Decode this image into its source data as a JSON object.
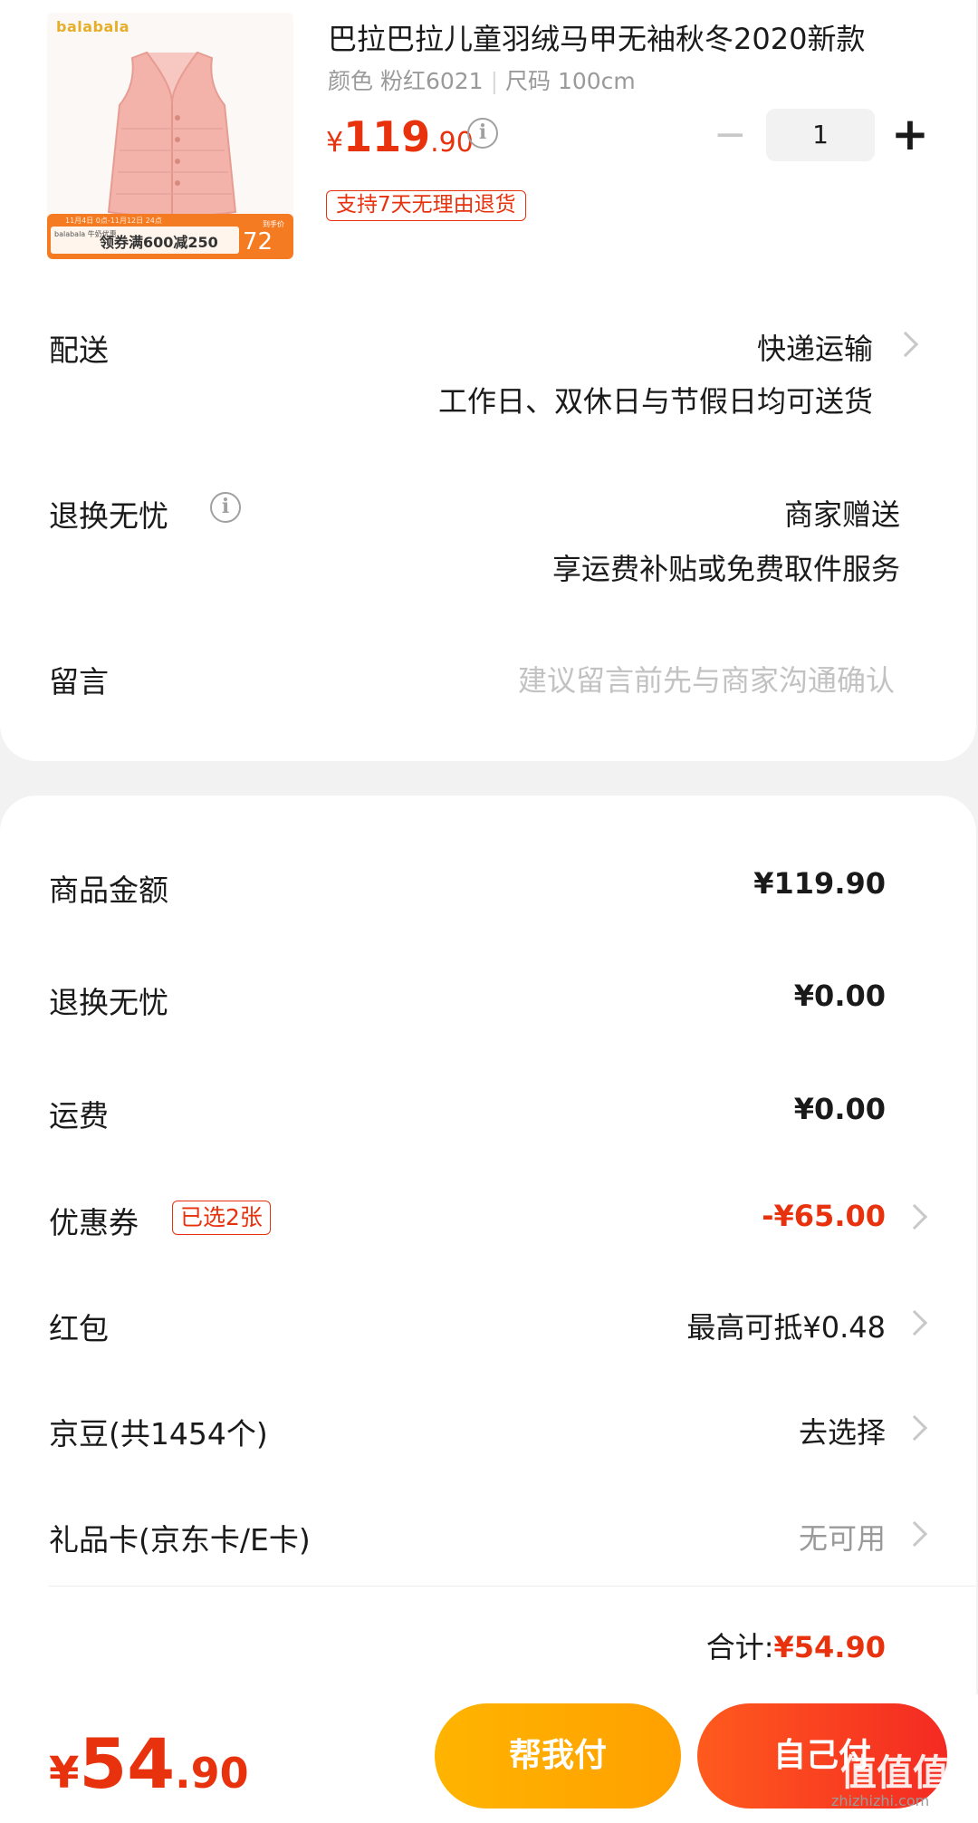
{
  "product": {
    "thumb_brand": "balabala",
    "promo_line": "11月4日 0点-11月12日 24点",
    "promo_brand": "balabala 牛奶优惠",
    "promo_coupon": "领券满600减250",
    "promo_price_label": "到手价",
    "promo_price": "72",
    "title": "巴拉巴拉儿童羽绒马甲无袖秋冬2020新款",
    "spec_color": "颜色 粉红6021",
    "spec_size": "尺码 100cm",
    "price_currency": "¥",
    "price_int": "119",
    "price_dec": ".90",
    "return_tag": "支持7天无理由退货",
    "quantity": "1",
    "qty_minus": "−",
    "qty_plus": "+"
  },
  "delivery": {
    "label": "配送",
    "method": "快递运输",
    "note": "工作日、双休日与节假日均可送货"
  },
  "return_worry": {
    "label": "退换无忧",
    "value": "商家赠送",
    "note": "享运费补贴或免费取件服务"
  },
  "message": {
    "label": "留言",
    "placeholder": "建议留言前先与商家沟通确认"
  },
  "summary": {
    "goods_label": "商品金额",
    "goods_value": "¥119.90",
    "return_label": "退换无忧",
    "return_value": "¥0.00",
    "shipping_label": "运费",
    "shipping_value": "¥0.00",
    "coupon_label": "优惠券",
    "coupon_tag": "已选2张",
    "coupon_value": "-¥65.00",
    "redpacket_label": "红包",
    "redpacket_value": "最高可抵¥0.48",
    "jingdou_label": "京豆(共1454个)",
    "jingdou_value": "去选择",
    "giftcard_label": "礼品卡(京东卡/E卡)",
    "giftcard_value": "无可用",
    "total_label": "合计:",
    "total_value": "¥54.90"
  },
  "bottom": {
    "total_currency": "¥",
    "total_int": "54",
    "total_dec": ".90",
    "help_pay": "帮我付",
    "self_pay": "自己付",
    "watermark": "值值值",
    "watermark_url": "zhizhizhi.com"
  },
  "colors": {
    "accent_red": "#e8320e",
    "help_button": "#ffb400",
    "self_button": "#f42a22"
  }
}
